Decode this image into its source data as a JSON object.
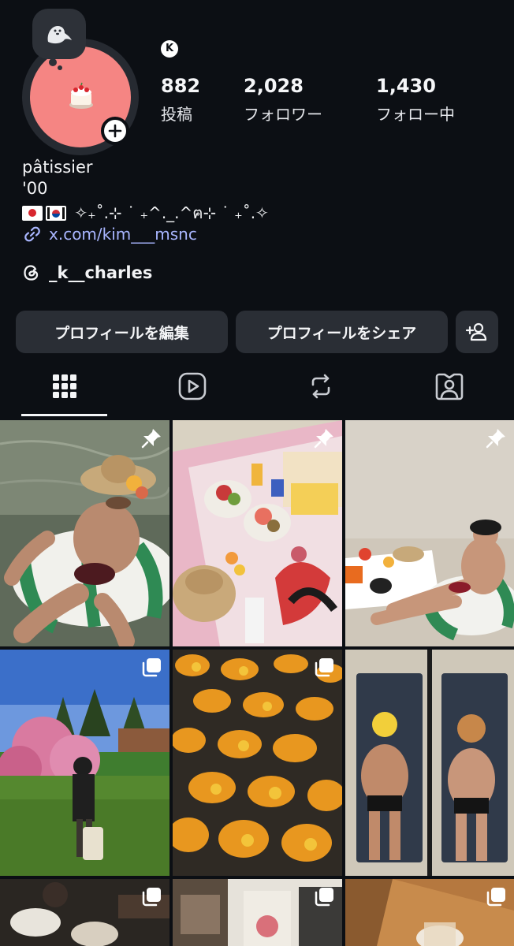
{
  "note_bubble": {
    "icon": "seal-icon"
  },
  "profile": {
    "badge_letter": "K",
    "stats": [
      {
        "value": "882",
        "label": "投稿"
      },
      {
        "value": "2,028",
        "label": "フォロワー"
      },
      {
        "value": "1,430",
        "label": "フォロー中"
      }
    ],
    "name": "pâtissier",
    "bio_line2": "'00",
    "bio_line3_text": "✧₊˚.⊹ ˙ ₊^._.^ฅ⊹ ˙ ₊˚.✧",
    "flags": [
      "japan-flag",
      "korea-flag"
    ],
    "link": "x.com/kim___msnc",
    "threads_handle": "_k__charles"
  },
  "buttons": {
    "edit_profile": "プロフィールを編集",
    "share_profile": "プロフィールをシェア",
    "add_person_icon": "person-add-icon"
  },
  "tabs": [
    {
      "name": "posts-grid",
      "icon": "grid-icon",
      "active": true
    },
    {
      "name": "reels",
      "icon": "reels-icon",
      "active": false
    },
    {
      "name": "reposts",
      "icon": "repost-icon",
      "active": false
    },
    {
      "name": "tagged",
      "icon": "tagged-person-icon",
      "active": false
    }
  ],
  "posts": [
    {
      "badge": "pin-icon",
      "subject": "man in swim ring at lake"
    },
    {
      "badge": "pin-icon",
      "subject": "picnic blanket with fruit"
    },
    {
      "badge": "pin-icon",
      "subject": "man on striped float at beach"
    },
    {
      "badge": "carousel-icon",
      "subject": "cherry blossom park"
    },
    {
      "badge": "carousel-icon",
      "subject": "orange flower beds"
    },
    {
      "badge": "carousel-icon",
      "subject": "mirror selfie comparison"
    },
    {
      "badge": "carousel-icon",
      "subject": "dining table"
    },
    {
      "badge": "carousel-icon",
      "subject": "cafe interior"
    },
    {
      "badge": "carousel-icon",
      "subject": "drink on wooden table"
    }
  ],
  "colors": {
    "background": "#0c0f14",
    "avatar": "#f58583",
    "button": "#2a2e35",
    "link": "#a9b6ff"
  }
}
